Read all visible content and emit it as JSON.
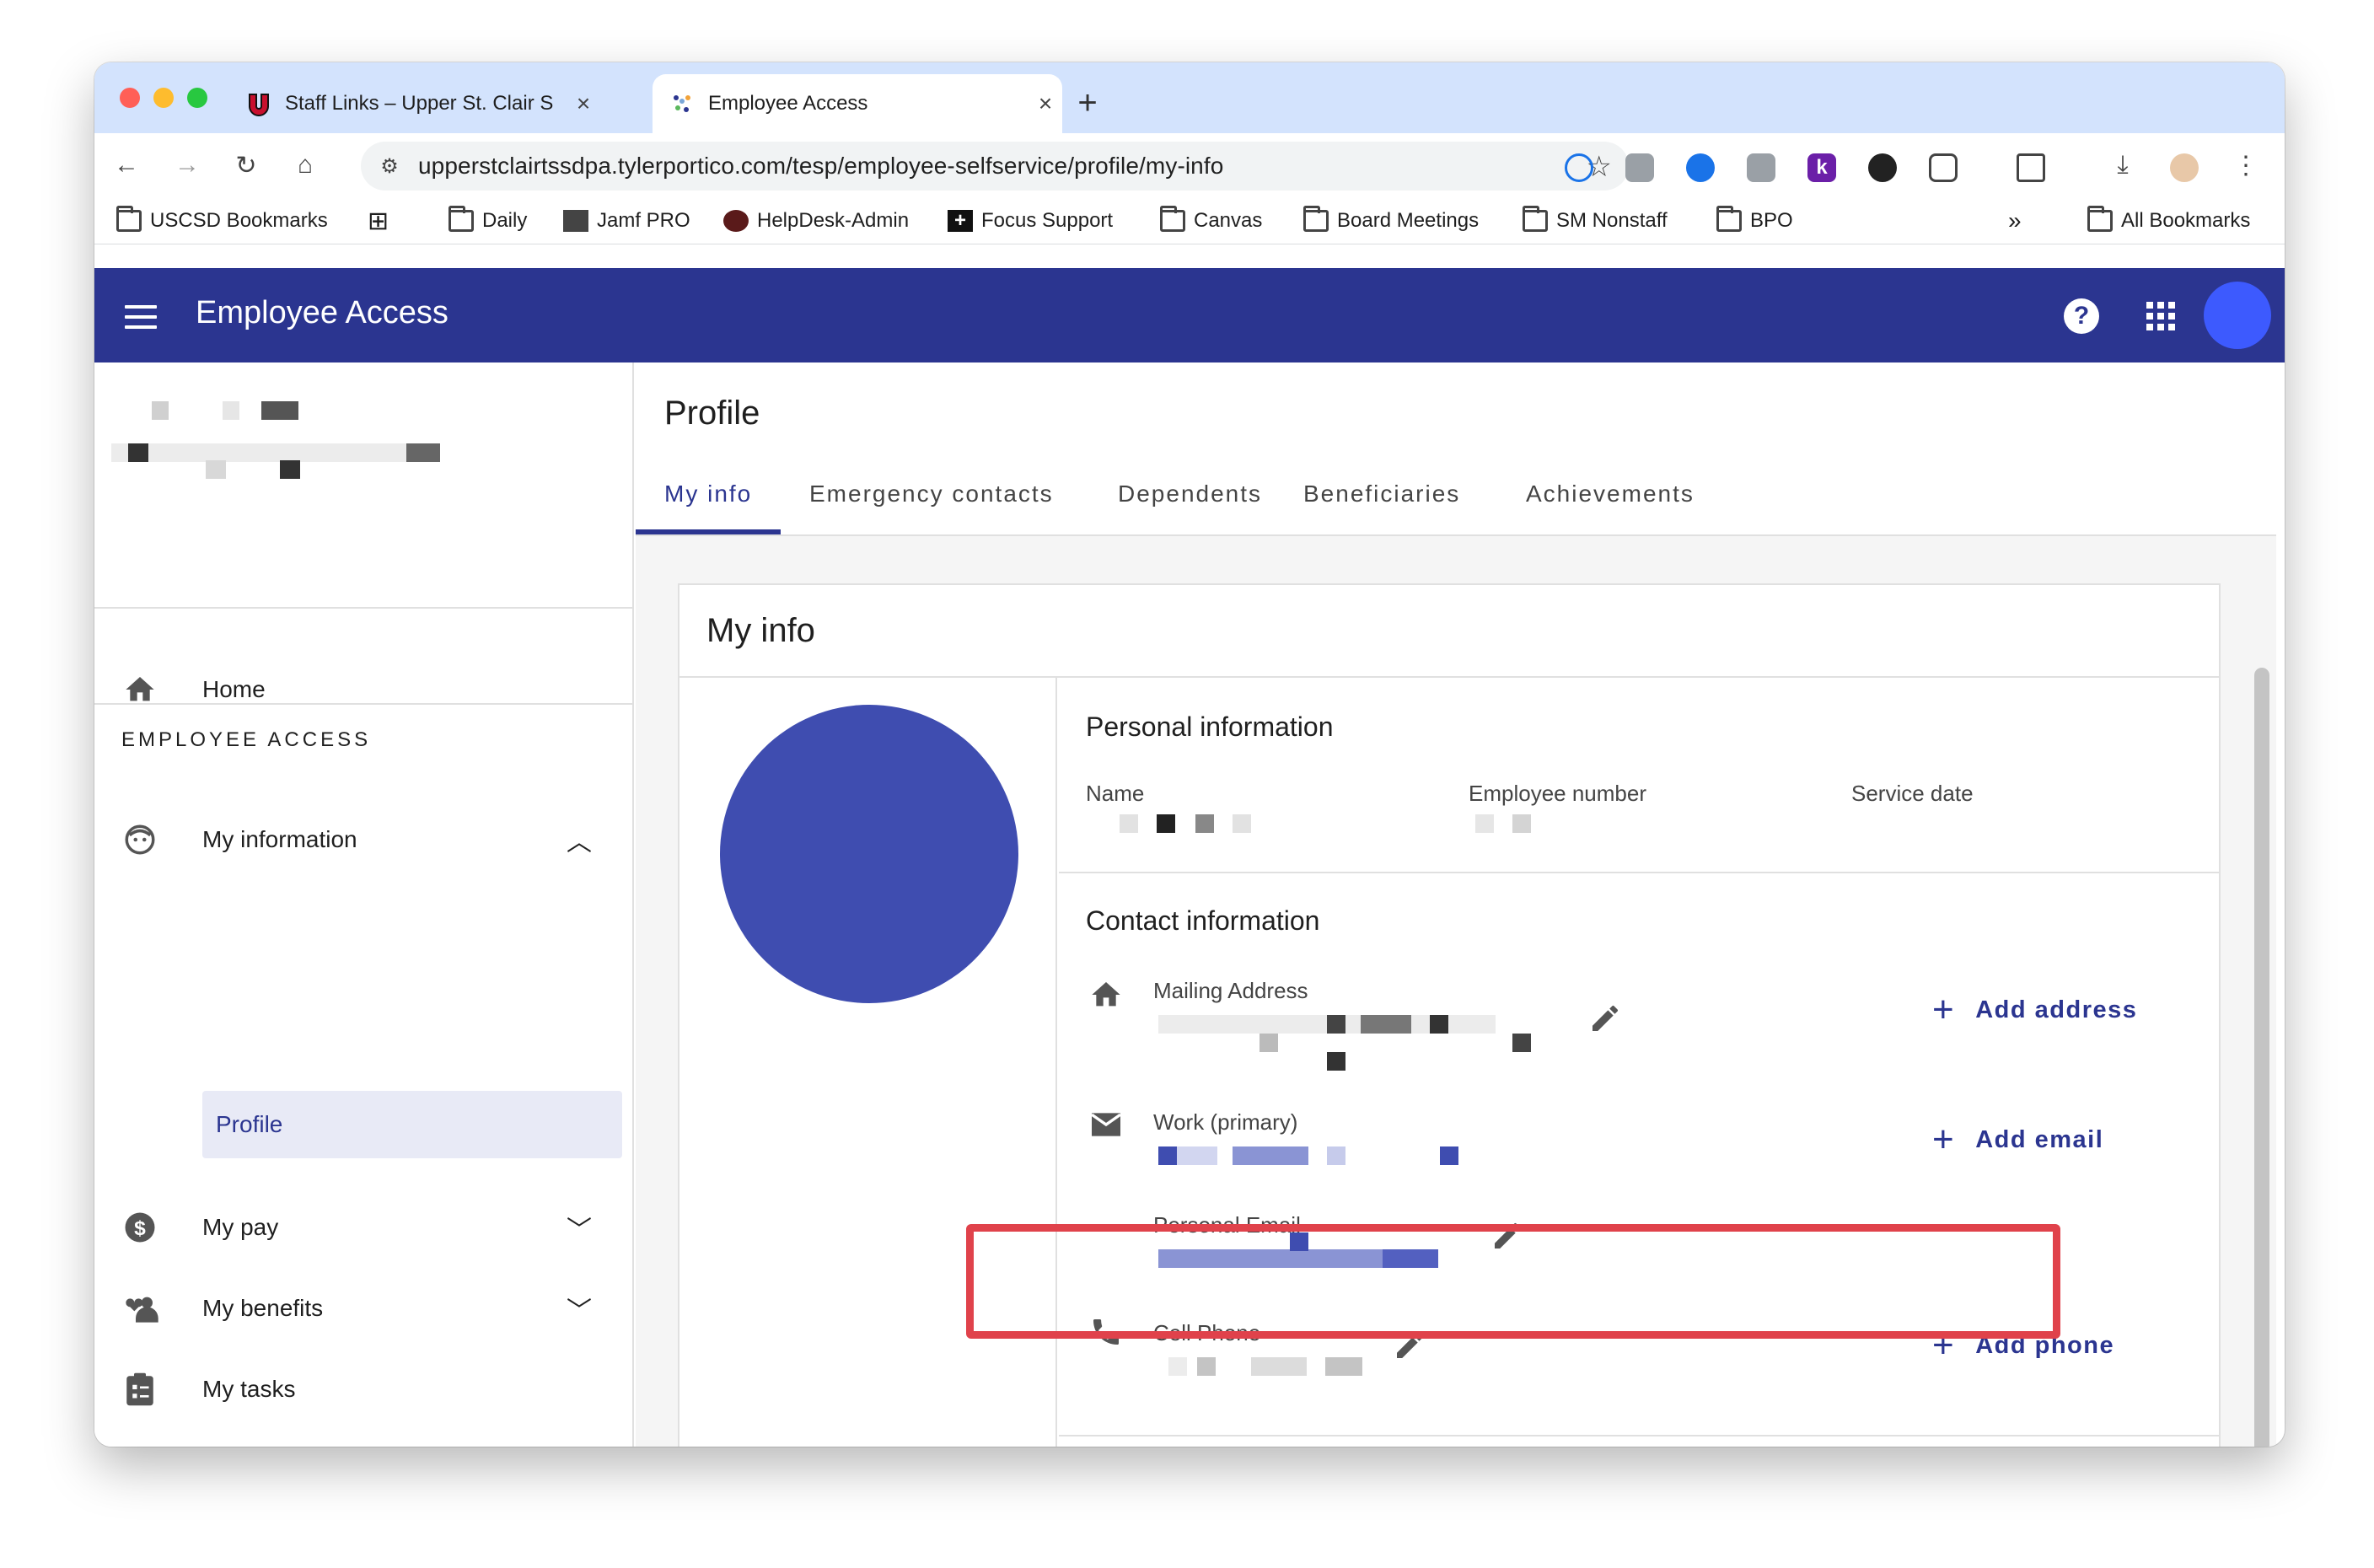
{
  "browser": {
    "tabs": [
      {
        "title": "Staff Links – Upper St. Clair S",
        "active": false
      },
      {
        "title": "Employee Access",
        "active": true
      }
    ],
    "url": "upperstclairtssdpa.tylerportico.com/tesp/employee-selfservice/profile/my-info",
    "bookmarks": [
      "USCSD Bookmarks",
      "Daily",
      "Jamf PRO",
      "HelpDesk-Admin",
      "Focus Support",
      "Canvas",
      "Board Meetings",
      "SM Nonstaff",
      "BPO"
    ],
    "all_bookmarks": "All Bookmarks",
    "overflow": "»"
  },
  "app": {
    "title": "Employee Access",
    "help": "?",
    "colors": {
      "primary": "#2b3590",
      "accent": "#3d5afe",
      "highlight": "#e0424b"
    }
  },
  "sidebar": {
    "home": "Home",
    "section": "EMPLOYEE ACCESS",
    "my_information": "My information",
    "profile": "Profile",
    "my_pay": "My pay",
    "my_benefits": "My benefits",
    "my_tasks": "My tasks"
  },
  "page": {
    "title": "Profile",
    "tabs": [
      "My info",
      "Emergency contacts",
      "Dependents",
      "Beneficiaries",
      "Achievements"
    ]
  },
  "card": {
    "title": "My info",
    "personal": {
      "heading": "Personal information",
      "name_label": "Name",
      "employee_number_label": "Employee number",
      "service_date_label": "Service date"
    },
    "contact": {
      "heading": "Contact information",
      "mailing_label": "Mailing Address",
      "work_label": "Work (primary)",
      "personal_email_label": "Personal Email",
      "cell_label": "Cell Phone",
      "add_address": "Add address",
      "add_email": "Add email",
      "add_phone": "Add phone"
    }
  }
}
